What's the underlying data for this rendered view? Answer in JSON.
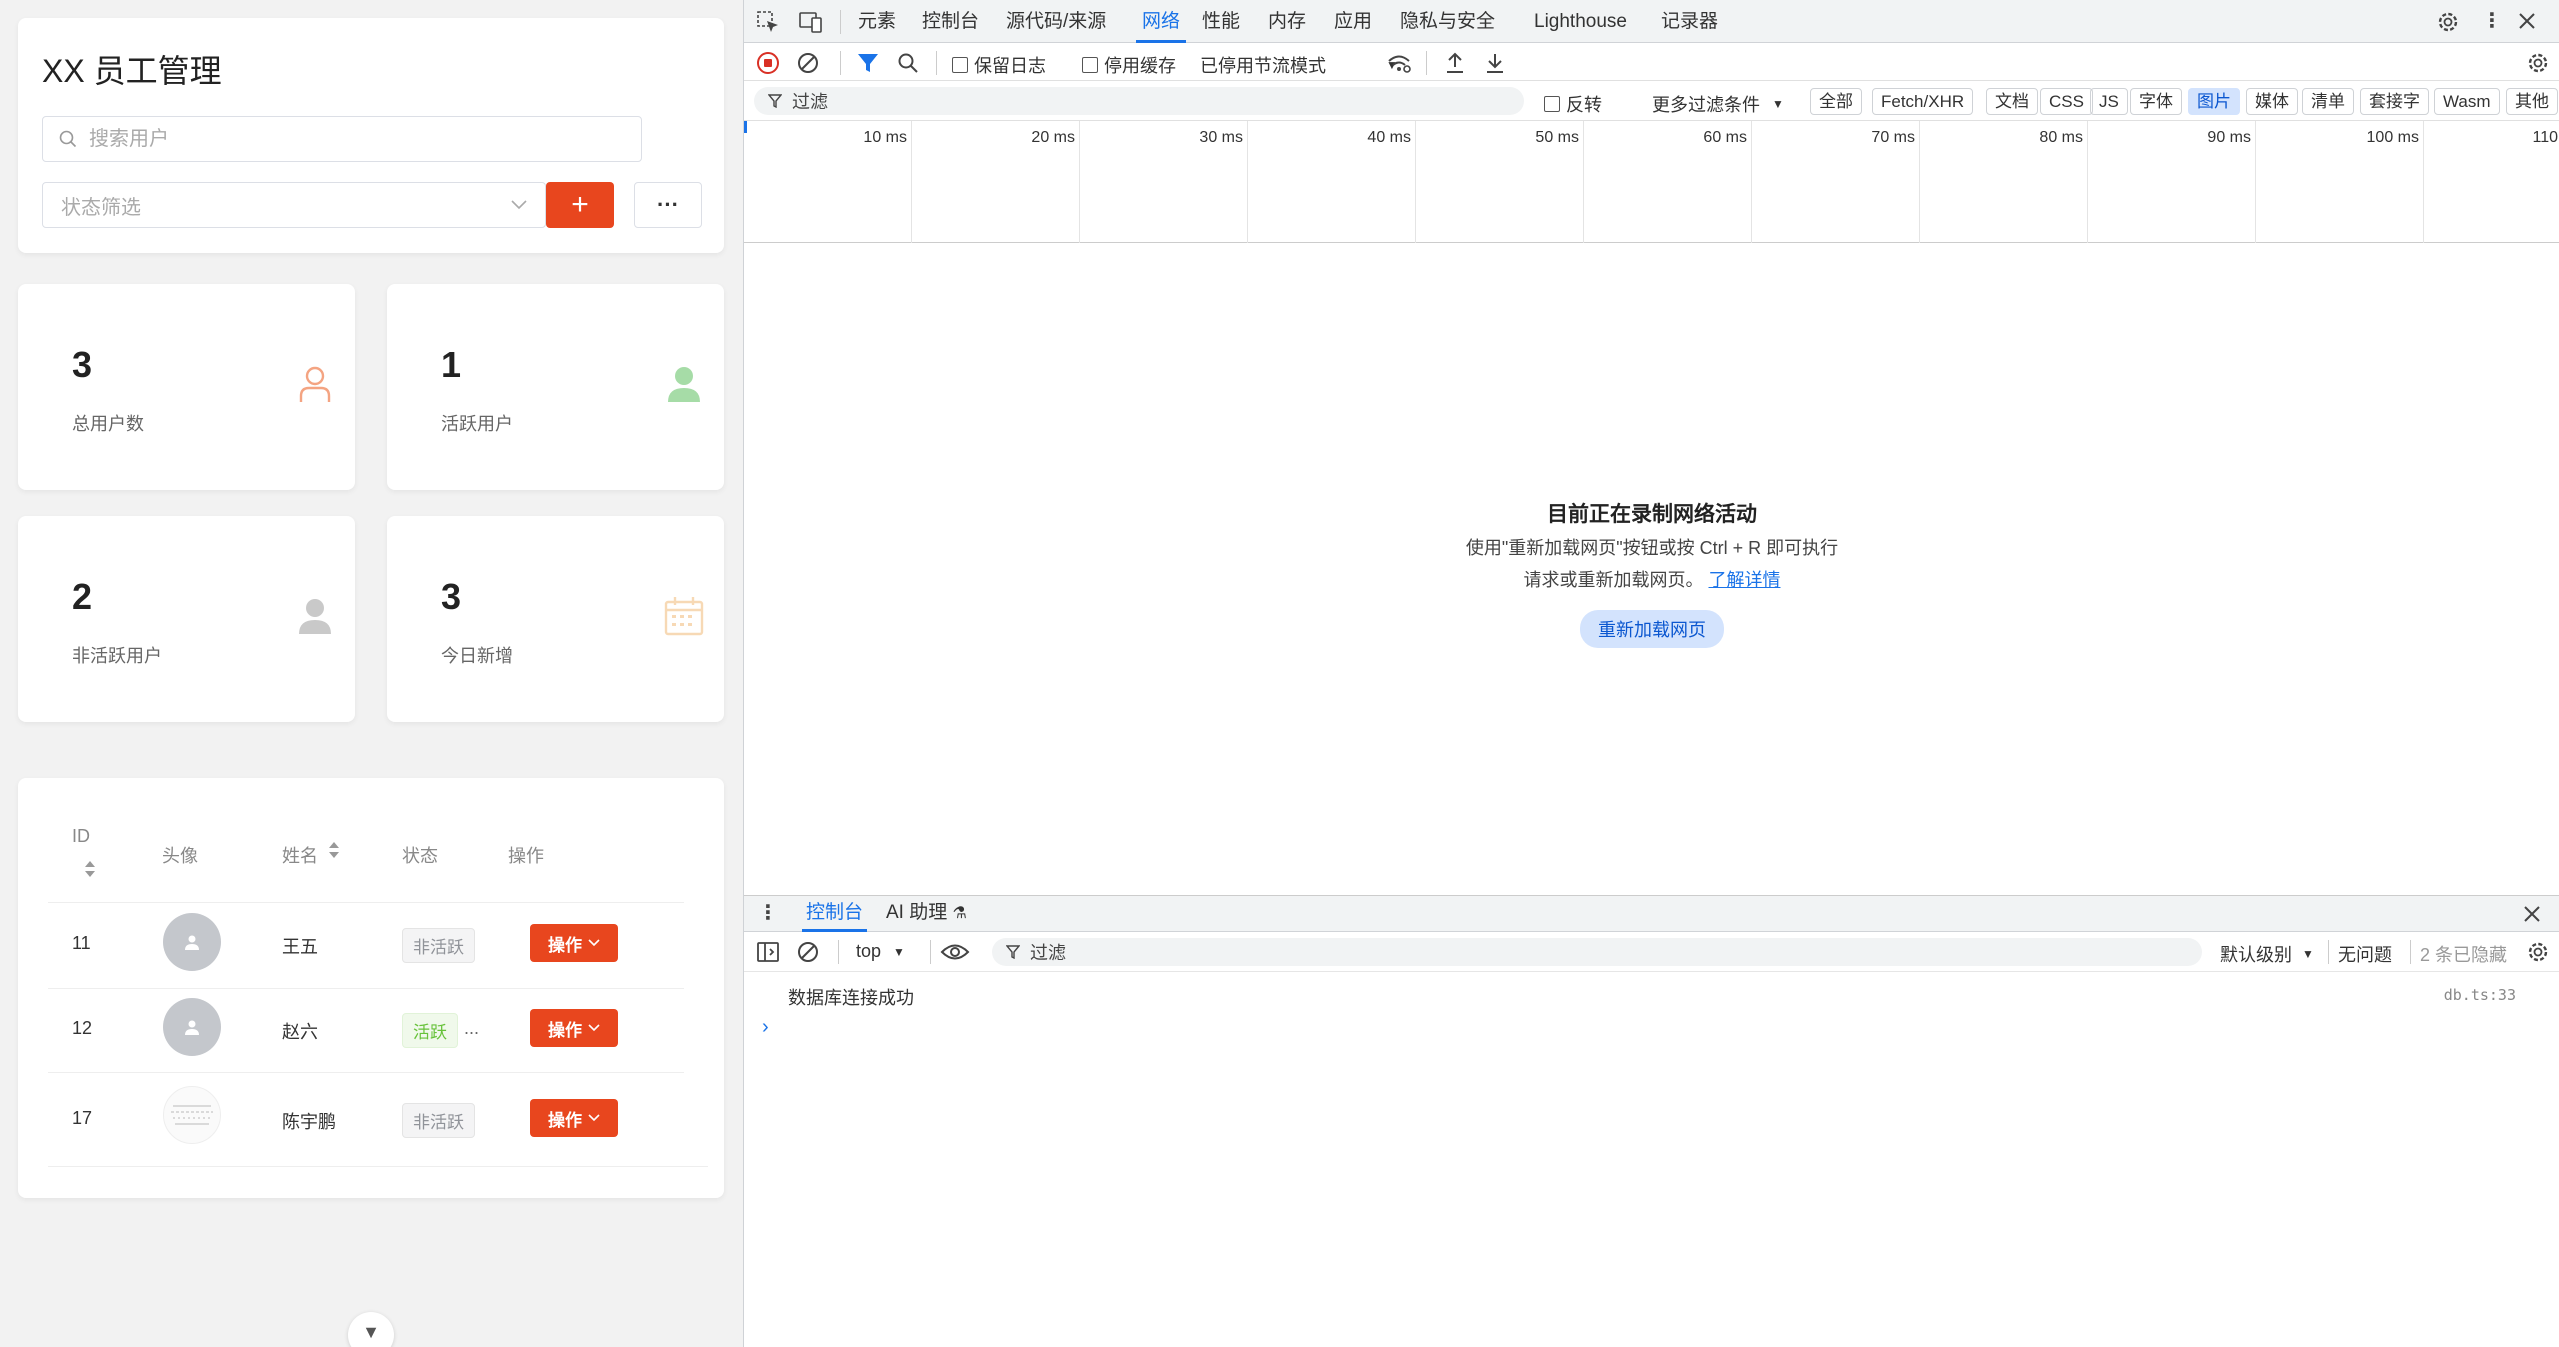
{
  "app": {
    "title": "XX 员工管理",
    "search": {
      "placeholder": "搜索用户",
      "value": ""
    },
    "status_filter": {
      "placeholder": "状态筛选"
    },
    "add_label": "+",
    "more_label": "···",
    "stats": [
      {
        "value": "3",
        "label": "总用户数",
        "icon": "user-outline-icon",
        "color": "#f4a482"
      },
      {
        "value": "1",
        "label": "活跃用户",
        "icon": "user-filled-icon",
        "color": "#a6dca7"
      },
      {
        "value": "2",
        "label": "非活跃用户",
        "icon": "user-filled-icon",
        "color": "#c9c9c9"
      },
      {
        "value": "3",
        "label": "今日新增",
        "icon": "calendar-icon",
        "color": "#f7d9b5"
      }
    ],
    "table": {
      "headers": {
        "id": "ID",
        "avatar": "头像",
        "name": "姓名",
        "status": "状态",
        "action": "操作"
      },
      "rows": [
        {
          "id": "11",
          "name": "王五",
          "status": "非活跃",
          "status_type": "inactive",
          "action": "操作",
          "avatar_type": "default"
        },
        {
          "id": "12",
          "name": "赵六",
          "status": "活跃",
          "status_type": "active",
          "ellipsis": "...",
          "action": "操作",
          "avatar_type": "default"
        },
        {
          "id": "17",
          "name": "陈宇鹏",
          "status": "非活跃",
          "status_type": "inactive",
          "action": "操作",
          "avatar_type": "image"
        }
      ]
    },
    "scroll_arrow": "▼"
  },
  "devtools": {
    "tabs": [
      "元素",
      "控制台",
      "源代码/来源",
      "网络",
      "性能",
      "内存",
      "应用",
      "隐私与安全",
      "Lighthouse",
      "记录器"
    ],
    "selected_tab": "网络",
    "toolbar": {
      "preserve_log": "保留日志",
      "disable_cache": "停用缓存",
      "throttle": "已停用节流模式"
    },
    "filter": {
      "placeholder": "过滤",
      "invert": "反转",
      "more_filters": "更多过滤条件"
    },
    "type_filters": [
      "全部",
      "Fetch/XHR",
      "文档",
      "CSS",
      "JS",
      "字体",
      "图片",
      "媒体",
      "清单",
      "套接字",
      "Wasm",
      "其他"
    ],
    "selected_type": "图片",
    "timeline_ticks": [
      "10 ms",
      "20 ms",
      "30 ms",
      "40 ms",
      "50 ms",
      "60 ms",
      "70 ms",
      "80 ms",
      "90 ms",
      "100 ms",
      "110"
    ],
    "empty": {
      "title": "目前正在录制网络活动",
      "desc_line1": "使用\"重新加载网页\"按钮或按 Ctrl + R 即可执行",
      "desc_line2": "请求或重新加载网页。",
      "link": "了解详情",
      "reload_button": "重新加载网页"
    },
    "drawer": {
      "tabs": [
        "控制台",
        "AI 助理"
      ],
      "context": "top",
      "filter_placeholder": "过滤",
      "level": "默认级别",
      "issues": "无问题",
      "hidden": "2 条已隐藏",
      "messages": [
        {
          "text": "数据库连接成功",
          "source": "db.ts:33"
        }
      ]
    }
  }
}
